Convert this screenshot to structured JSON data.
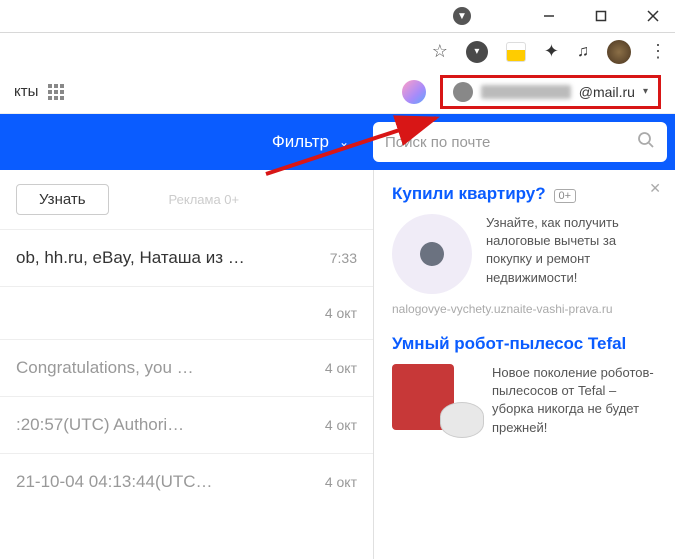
{
  "window": {
    "dropdown_indicator": "▼"
  },
  "mail_header": {
    "projects_label": "кты",
    "user_email_suffix": "@mail.ru"
  },
  "toolbar": {
    "filter_label": "Фильтр",
    "search_placeholder": "Поиск по почте"
  },
  "promo": {
    "learn_label": "Узнать",
    "ad_label": "Реклама 0+"
  },
  "mails": [
    {
      "subject": "ob, hh.ru, eBay, Наташа из …",
      "time": "7:33",
      "gray": false
    },
    {
      "subject": "",
      "time": "4 окт",
      "gray": false
    },
    {
      "subject": "Congratulations, you …",
      "time": "4 окт",
      "gray": true
    },
    {
      "subject": ":20:57(UTC)    Authori…",
      "time": "4 окт",
      "gray": true
    },
    {
      "subject": "21-10-04 04:13:44(UTC…",
      "time": "4 окт",
      "gray": true
    }
  ],
  "ads": {
    "ad1": {
      "title": "Купили квартиру?",
      "age": "0+",
      "text": "Узнайте, как получить налоговые вычеты за покупку и ремонт недвижимости!",
      "source": "nalogovye-vychety.uznaite-vashi-prava.ru"
    },
    "ad2": {
      "title": "Умный робот-пылесос Tefal",
      "text": "Новое поколение роботов-пылесосов от Tefal – уборка никогда не будет прежней!"
    }
  }
}
